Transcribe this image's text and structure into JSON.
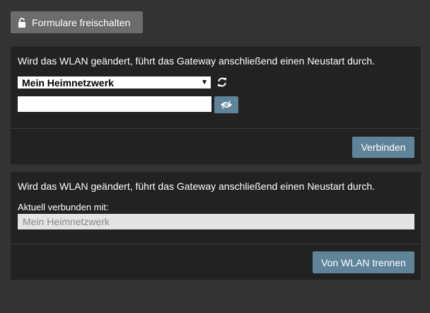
{
  "unlock_button": {
    "label": "Formulare freischalten",
    "icon": "lock-open-icon"
  },
  "connect_panel": {
    "message": "Wird das WLAN geändert, führt das Gateway anschließend einen Neustart durch.",
    "ssid_select": {
      "selected": "Mein Heimnetzwerk",
      "arrow": "▼"
    },
    "refresh_icon": "refresh-icon",
    "password": {
      "value": "",
      "placeholder": ""
    },
    "show_password_icon": "eye-slash-icon",
    "connect_label": "Verbinden"
  },
  "status_panel": {
    "message": "Wird das WLAN geändert, führt das Gateway anschließend einen Neustart durch.",
    "current_label": "Aktuell verbunden mit:",
    "current_value": "Mein Heimnetzwerk",
    "disconnect_label": "Von WLAN trennen"
  },
  "colors": {
    "background": "#333333",
    "panel": "#222222",
    "accent_button": "#5f8499",
    "secondary_button": "#6c6c6c"
  }
}
